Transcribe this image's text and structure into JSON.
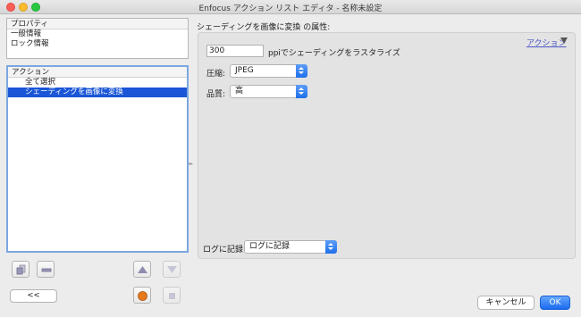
{
  "window": {
    "title": "Enfocus アクション リスト エディタ - 名称未設定"
  },
  "properties_panel": {
    "header": "プロパティ",
    "items": [
      "一般情報",
      "ロック情報"
    ]
  },
  "action_panel": {
    "header": "アクション",
    "items": [
      {
        "label": "全て選択",
        "selected": false
      },
      {
        "label": "シェーディングを画像に変換",
        "selected": true
      }
    ]
  },
  "left_toolbar": {
    "back_label": "<<",
    "buttons": [
      "add-action-icon",
      "remove-action-icon",
      "move-up-icon",
      "move-down-icon",
      "record-icon",
      "stop-icon"
    ]
  },
  "detail": {
    "title": "シェーディングを画像に変換 の属性:",
    "action_link": "アクション",
    "ppi_value": "300",
    "ppi_label": "ppiでシェーディングをラスタライズ",
    "compression_label": "圧縮:",
    "compression_value": "JPEG",
    "quality_label": "品質:",
    "quality_value": "高",
    "log_label": "ログに記録",
    "log_value": "ログに記録"
  },
  "footer": {
    "cancel_label": "キャンセル",
    "ok_label": "OK"
  },
  "colors": {
    "selection": "#1a56d6",
    "primary_button": "#1b6bf0",
    "link": "#4a57c4"
  }
}
